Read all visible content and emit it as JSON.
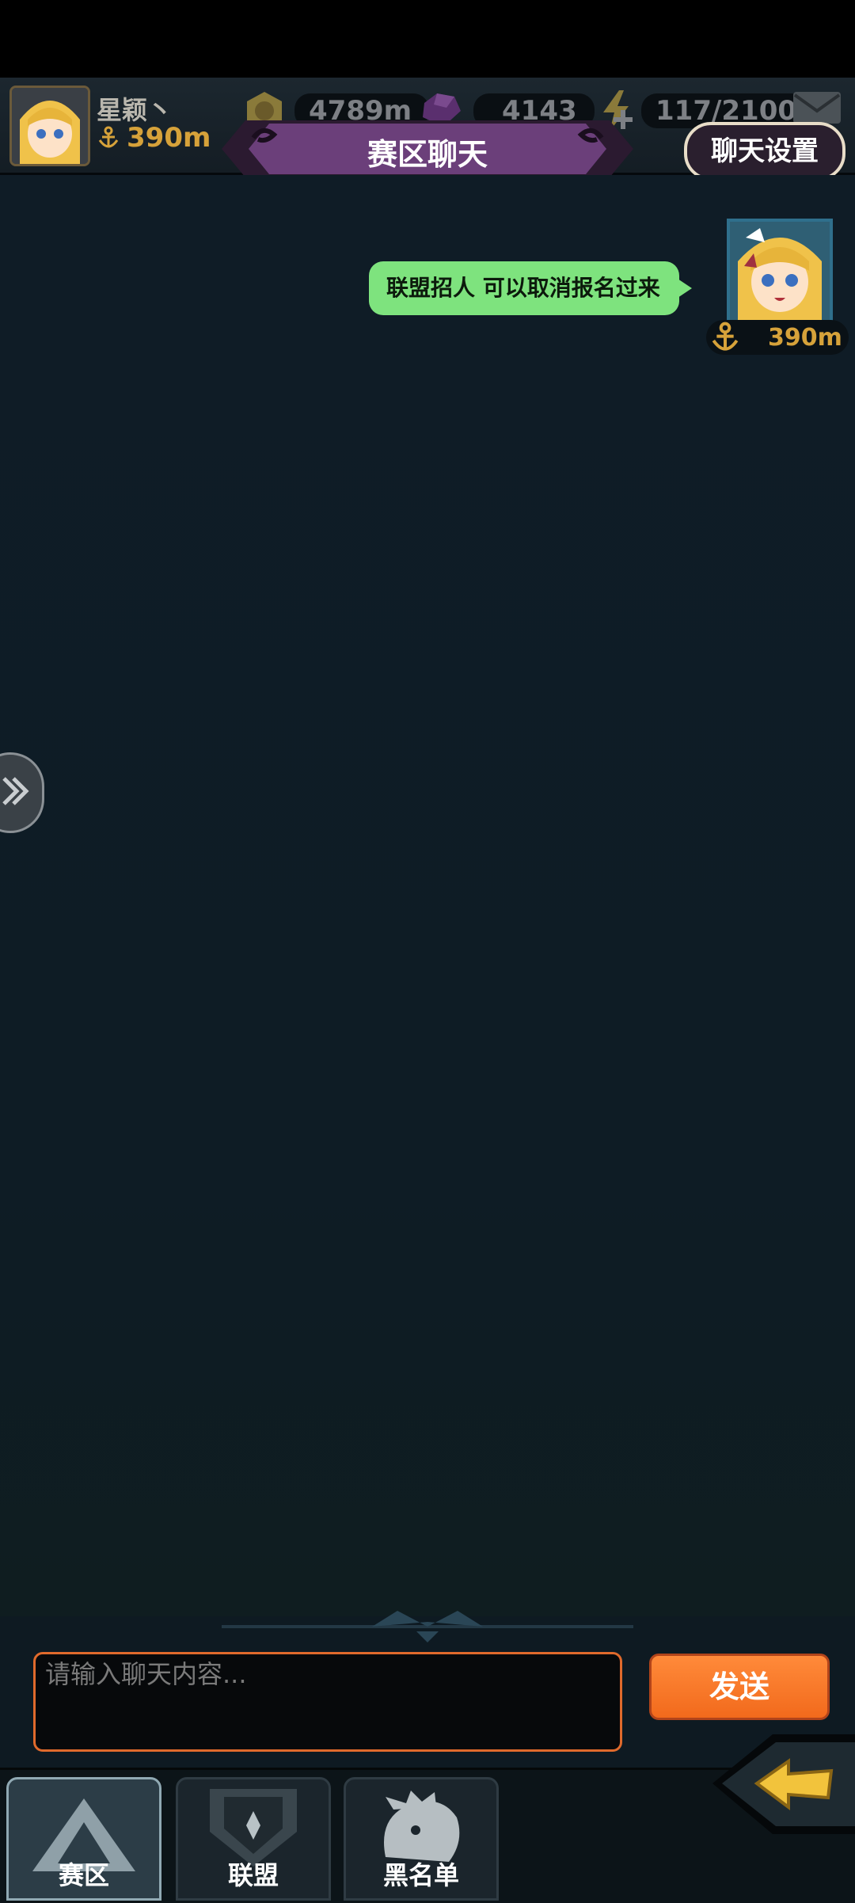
{
  "header": {
    "player_name": "星颖丶",
    "player_depth": "390m",
    "resources": [
      {
        "name": "gold",
        "icon": "gold-coin-icon",
        "value": "4789m"
      },
      {
        "name": "gem",
        "icon": "purple-gem-icon",
        "value": "4143"
      },
      {
        "name": "energy",
        "icon": "lightning-icon",
        "value": "117/2100"
      }
    ],
    "title": "赛区聊天",
    "settings_label": "聊天设置"
  },
  "messages": [
    {
      "text": "联盟招人 可以取消报名过来",
      "depth": "390m",
      "side": "right"
    }
  ],
  "composer": {
    "placeholder": "请输入聊天内容...",
    "value": "",
    "send_label": "发送"
  },
  "tabs": [
    {
      "label": "赛区",
      "active": true
    },
    {
      "label": "联盟",
      "active": false
    },
    {
      "label": "黑名单",
      "active": false
    }
  ],
  "colors": {
    "bubble": "#7ee37e",
    "accent_orange": "#f26a1c",
    "gold": "#d6a23a",
    "banner_purple": "#6b3f7a"
  }
}
